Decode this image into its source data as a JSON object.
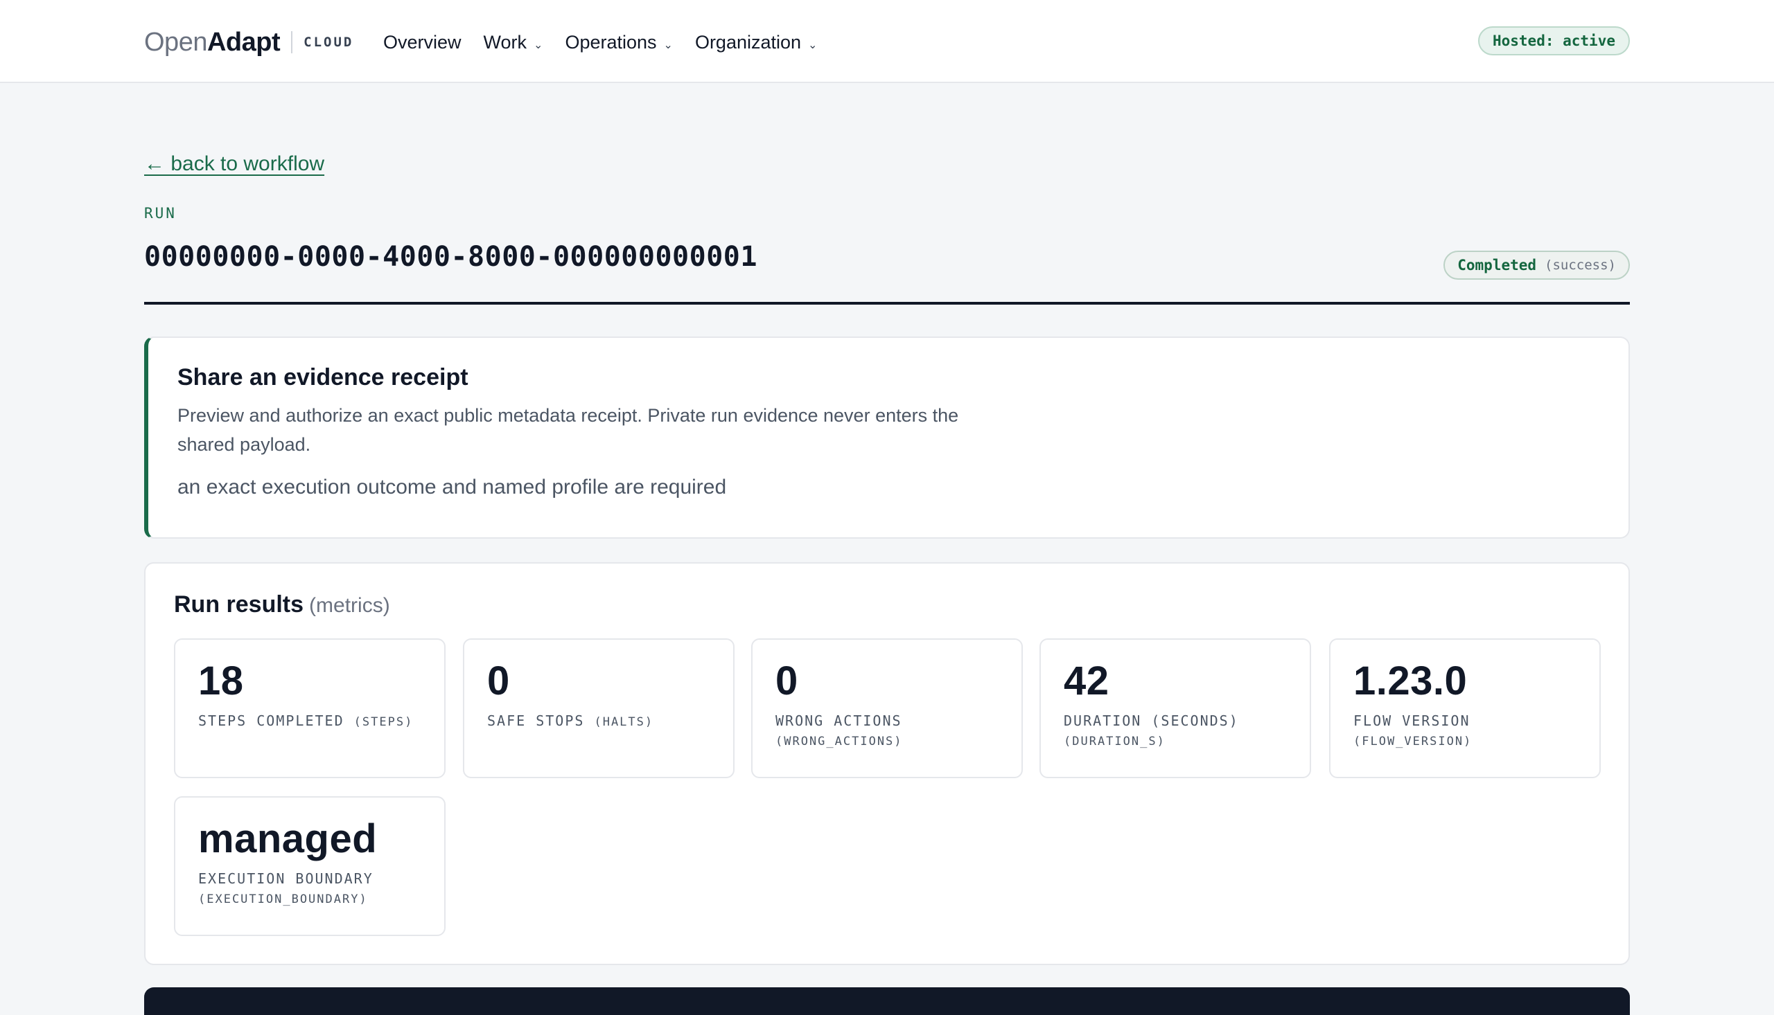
{
  "brand": {
    "logo_light": "Open",
    "logo_bold": "Adapt",
    "tag": "CLOUD"
  },
  "nav": {
    "items": [
      {
        "label": "Overview",
        "has_menu": false
      },
      {
        "label": "Work",
        "has_menu": true
      },
      {
        "label": "Operations",
        "has_menu": true
      },
      {
        "label": "Organization",
        "has_menu": true
      }
    ],
    "chevron": "⌄"
  },
  "hosted_status": "Hosted: active",
  "back_link": "← back to workflow",
  "eyebrow": "RUN",
  "run_id": "00000000-0000-4000-8000-000000000001",
  "status": {
    "label": "Completed",
    "detail": "(success)"
  },
  "receipt": {
    "title": "Share an evidence receipt",
    "description": "Preview and authorize an exact public metadata receipt. Private run evidence never enters the shared payload.",
    "note": "an exact execution outcome and named profile are required"
  },
  "results": {
    "title": "Run results",
    "subtitle": "(metrics)",
    "metrics": [
      {
        "value": "18",
        "label": "Steps completed",
        "key": "(steps)"
      },
      {
        "value": "0",
        "label": "Safe stops",
        "key": "(halts)"
      },
      {
        "value": "0",
        "label": "Wrong actions",
        "key": "(wrong_actions)"
      },
      {
        "value": "42",
        "label": "Duration (seconds)",
        "key": "(duration_s)"
      },
      {
        "value": "1.23.0",
        "label": "Flow version",
        "key": "(flow_version)"
      },
      {
        "value": "managed",
        "label": "Execution boundary",
        "key": "(execution_boundary)"
      }
    ]
  }
}
